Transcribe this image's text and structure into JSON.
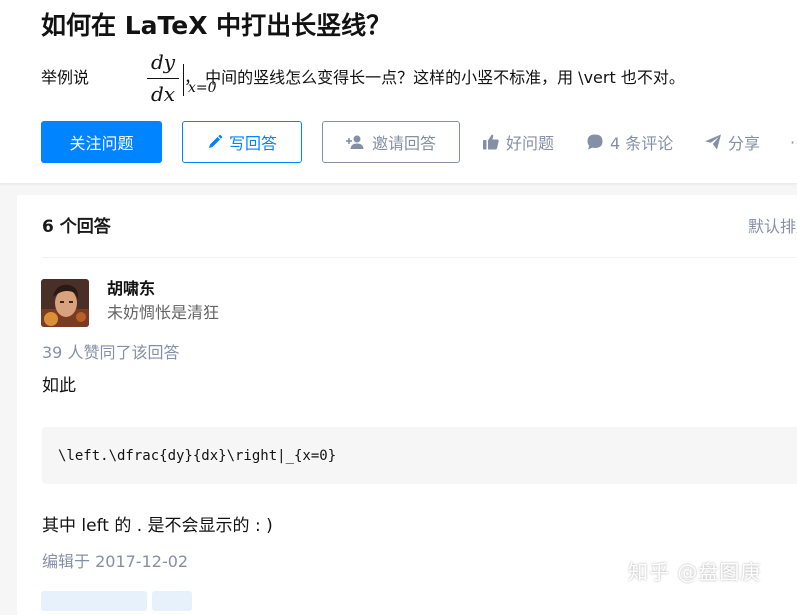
{
  "question": {
    "title": "如何在 LaTeX 中打出长竖线？",
    "detail_prefix": "举例说",
    "detail_suffix": "， 中间的竖线怎么变得长一点？这样的小竖不标准，用 \\vert 也不对。",
    "math": {
      "numerator": "dy",
      "denominator": "dx",
      "subscript": "x=0"
    }
  },
  "actions": {
    "follow": "关注问题",
    "write": "写回答",
    "invite": "邀请回答",
    "good_question": "好问题",
    "comments": "4 条评论",
    "share": "分享",
    "more": "···"
  },
  "answers": {
    "count_label": "6 个回答",
    "sort_label": "默认排序"
  },
  "answer": {
    "author": "胡啸东",
    "bio": "未妨惆怅是清狂",
    "votes": "39 人赞同了该回答",
    "para1": "如此",
    "code": "\\left.\\dfrac{dy}{dx}\\right|_{x=0}",
    "para2": "其中 left 的 . 是不会显示的 : )",
    "edited": "编辑于 2017-12-02"
  },
  "watermark": "知乎 @盘图庚",
  "colors": {
    "brand": "#0084ff",
    "muted": "#8590a6",
    "bg": "#f6f6f6"
  }
}
